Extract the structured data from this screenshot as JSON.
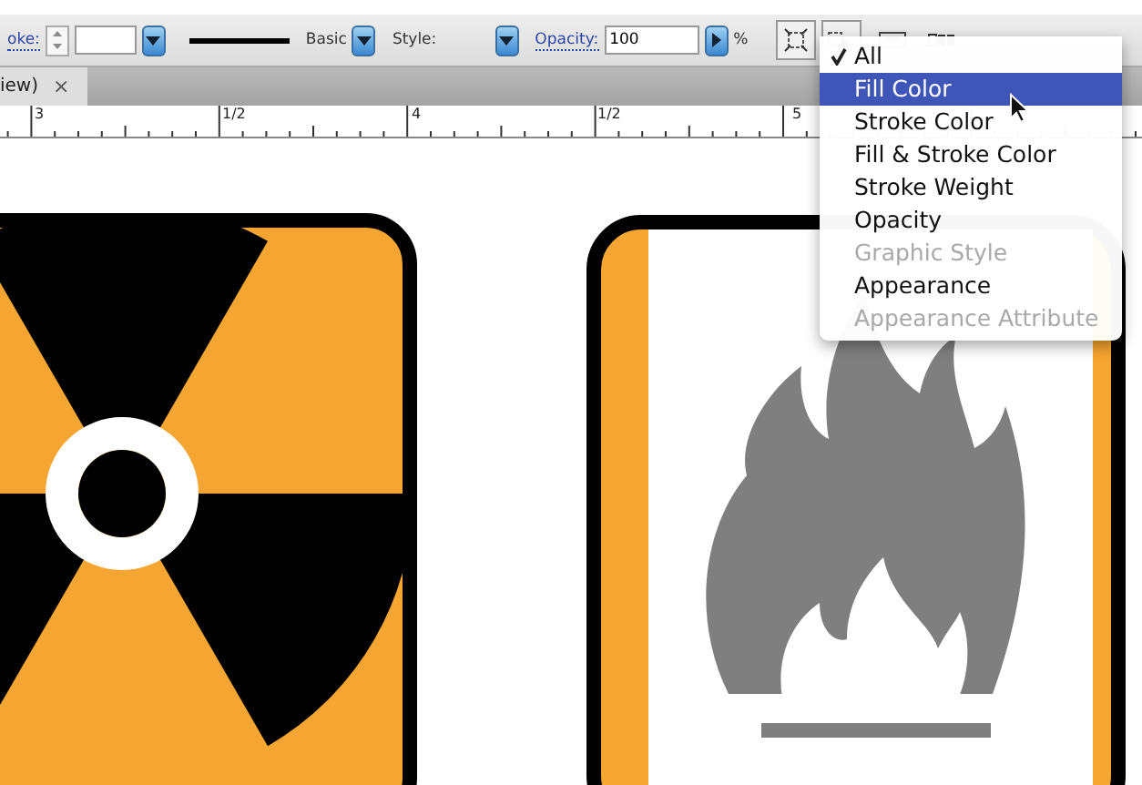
{
  "control_bar": {
    "stroke_label": "oke:",
    "stroke_style": "Basic",
    "style_label": "Style:",
    "opacity_label": "Opacity:",
    "opacity_value": "100",
    "opacity_unit": "%"
  },
  "document_tab": {
    "title": "iew)",
    "close": "×"
  },
  "ruler": {
    "labels": [
      "3",
      "1/2",
      "4",
      "1/2",
      "5"
    ]
  },
  "menu": {
    "items": [
      {
        "label": "All",
        "checked": true,
        "selected": false,
        "disabled": false
      },
      {
        "label": "Fill Color",
        "checked": false,
        "selected": true,
        "disabled": false
      },
      {
        "label": "Stroke Color",
        "checked": false,
        "selected": false,
        "disabled": false
      },
      {
        "label": "Fill & Stroke Color",
        "checked": false,
        "selected": false,
        "disabled": false
      },
      {
        "label": "Stroke Weight",
        "checked": false,
        "selected": false,
        "disabled": false
      },
      {
        "label": "Opacity",
        "checked": false,
        "selected": false,
        "disabled": false
      },
      {
        "label": "Graphic Style",
        "checked": false,
        "selected": false,
        "disabled": true
      },
      {
        "label": "Appearance",
        "checked": false,
        "selected": false,
        "disabled": false
      },
      {
        "label": "Appearance Attribute",
        "checked": false,
        "selected": false,
        "disabled": true
      }
    ]
  }
}
